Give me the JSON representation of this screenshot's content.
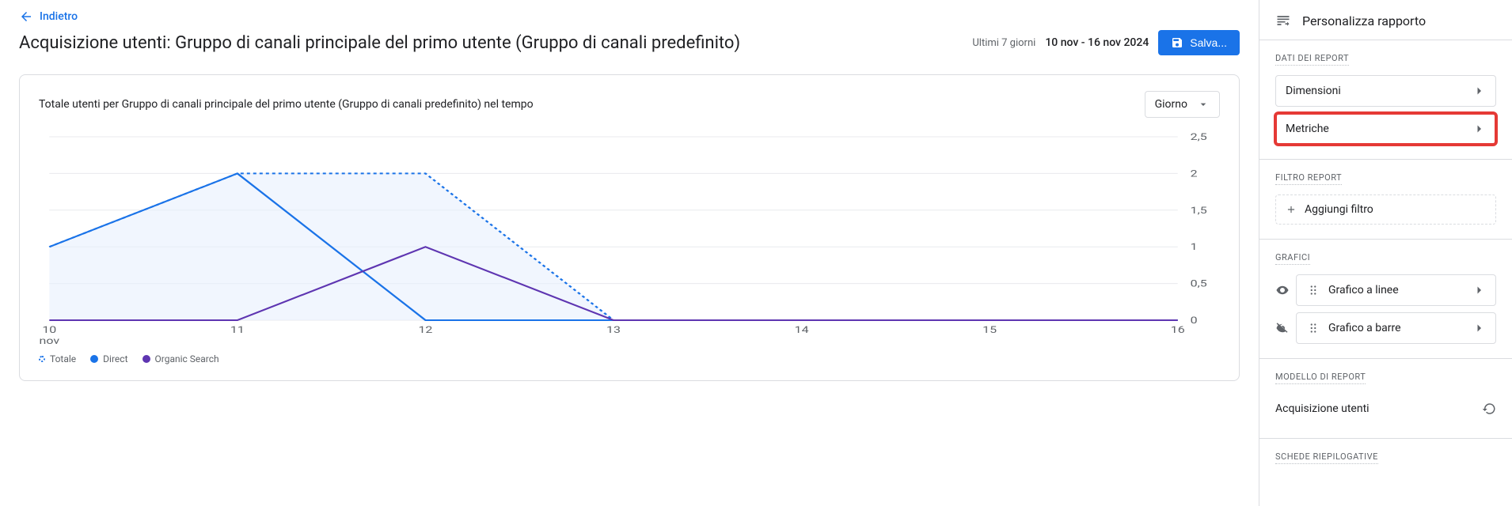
{
  "back_label": "Indietro",
  "page_title": "Acquisizione utenti: Gruppo di canali principale del primo utente (Gruppo di canali predefinito)",
  "date_prefix": "Ultimi 7 giorni",
  "date_range": "10 nov - 16 nov 2024",
  "save_label": "Salva...",
  "card": {
    "title": "Totale utenti per Gruppo di canali principale del primo utente (Gruppo di canali predefinito) nel tempo",
    "period": "Giorno"
  },
  "legend": {
    "total": "Totale",
    "direct": "Direct",
    "organic": "Organic Search"
  },
  "chart_data": {
    "type": "line",
    "xlabel": "",
    "ylabel": "",
    "ylim": [
      0,
      2.5
    ],
    "x_month_label": "nov",
    "categories": [
      "10",
      "11",
      "12",
      "13",
      "14",
      "15",
      "16"
    ],
    "yticks": [
      0,
      0.5,
      1,
      1.5,
      2,
      2.5
    ],
    "ytick_labels": [
      "0",
      "0,5",
      "1",
      "1,5",
      "2",
      "2,5"
    ],
    "series": [
      {
        "name": "Totale",
        "values": [
          1,
          2,
          2,
          0,
          0,
          0,
          0
        ],
        "style": "dashed-area",
        "color": "#1a73e8"
      },
      {
        "name": "Direct",
        "values": [
          1,
          2,
          0,
          0,
          0,
          0,
          0
        ],
        "style": "solid",
        "color": "#1a73e8"
      },
      {
        "name": "Organic Search",
        "values": [
          0,
          0,
          1,
          0,
          0,
          0,
          0
        ],
        "style": "solid",
        "color": "#5e35b1"
      }
    ]
  },
  "sidebar": {
    "title": "Personalizza rapporto",
    "sections": {
      "report_data": "DATI DEI REPORT",
      "filter": "FILTRO REPORT",
      "charts": "GRAFICI",
      "model": "MODELLO DI REPORT",
      "summary": "SCHEDE RIEPILOGATIVE"
    },
    "dimensions": "Dimensioni",
    "metrics": "Metriche",
    "add_filter": "Aggiungi filtro",
    "line_chart": "Grafico a linee",
    "bar_chart": "Grafico a barre",
    "model_name": "Acquisizione utenti"
  }
}
